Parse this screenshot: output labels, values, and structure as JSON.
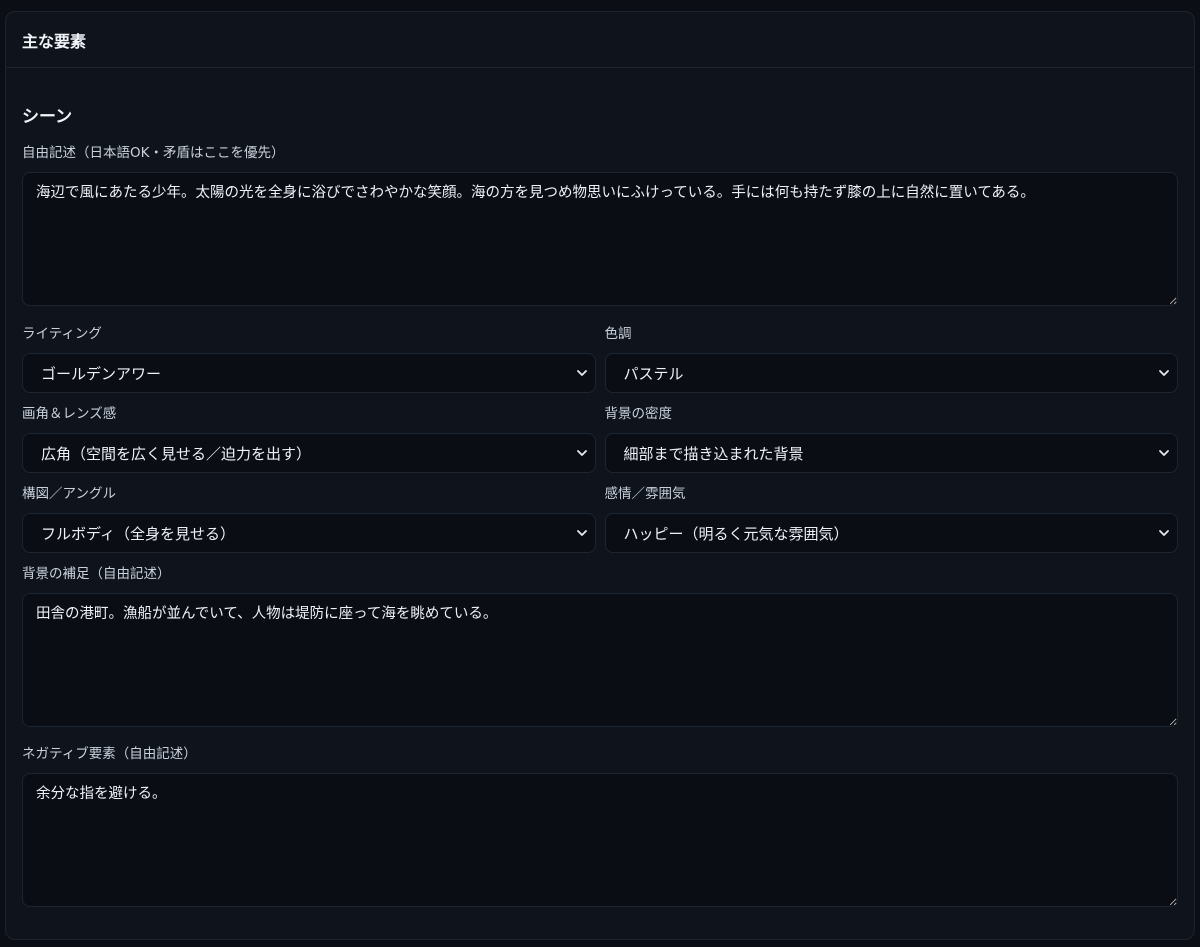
{
  "panel": {
    "title": "主な要素"
  },
  "scene": {
    "heading": "シーン",
    "free_text_label": "自由記述（日本語OK・矛盾はここを優先）",
    "free_text_value": "海辺で風にあたる少年。太陽の光を全身に浴びでさわやかな笑顔。海の方を見つめ物思いにふけっている。手には何も持たず膝の上に自然に置いてある。",
    "lighting_label": "ライティング",
    "lighting_value": "ゴールデンアワー",
    "color_tone_label": "色調",
    "color_tone_value": "パステル",
    "angle_lens_label": "画角＆レンズ感",
    "angle_lens_value": "広角（空間を広く見せる／迫力を出す）",
    "background_density_label": "背景の密度",
    "background_density_value": "細部まで描き込まれた背景",
    "composition_label": "構図／アングル",
    "composition_value": "フルボディ（全身を見せる）",
    "emotion_label": "感情／雰囲気",
    "emotion_value": "ハッピー（明るく元気な雰囲気）",
    "background_note_label": "背景の補足（自由記述）",
    "background_note_value": "田舎の港町。漁船が並んでいて、人物は堤防に座って海を眺めている。",
    "negative_label": "ネガティブ要素（自由記述）",
    "negative_value": "余分な指を避ける。"
  },
  "icons": {
    "chevron": "chevron-down-icon"
  },
  "colors": {
    "page_bg": "#0b0f15",
    "panel_bg": "#0f141c",
    "field_bg": "#0a0e14",
    "border": "#1d2531",
    "text": "#eef2f7",
    "label": "#c9d1dc"
  }
}
